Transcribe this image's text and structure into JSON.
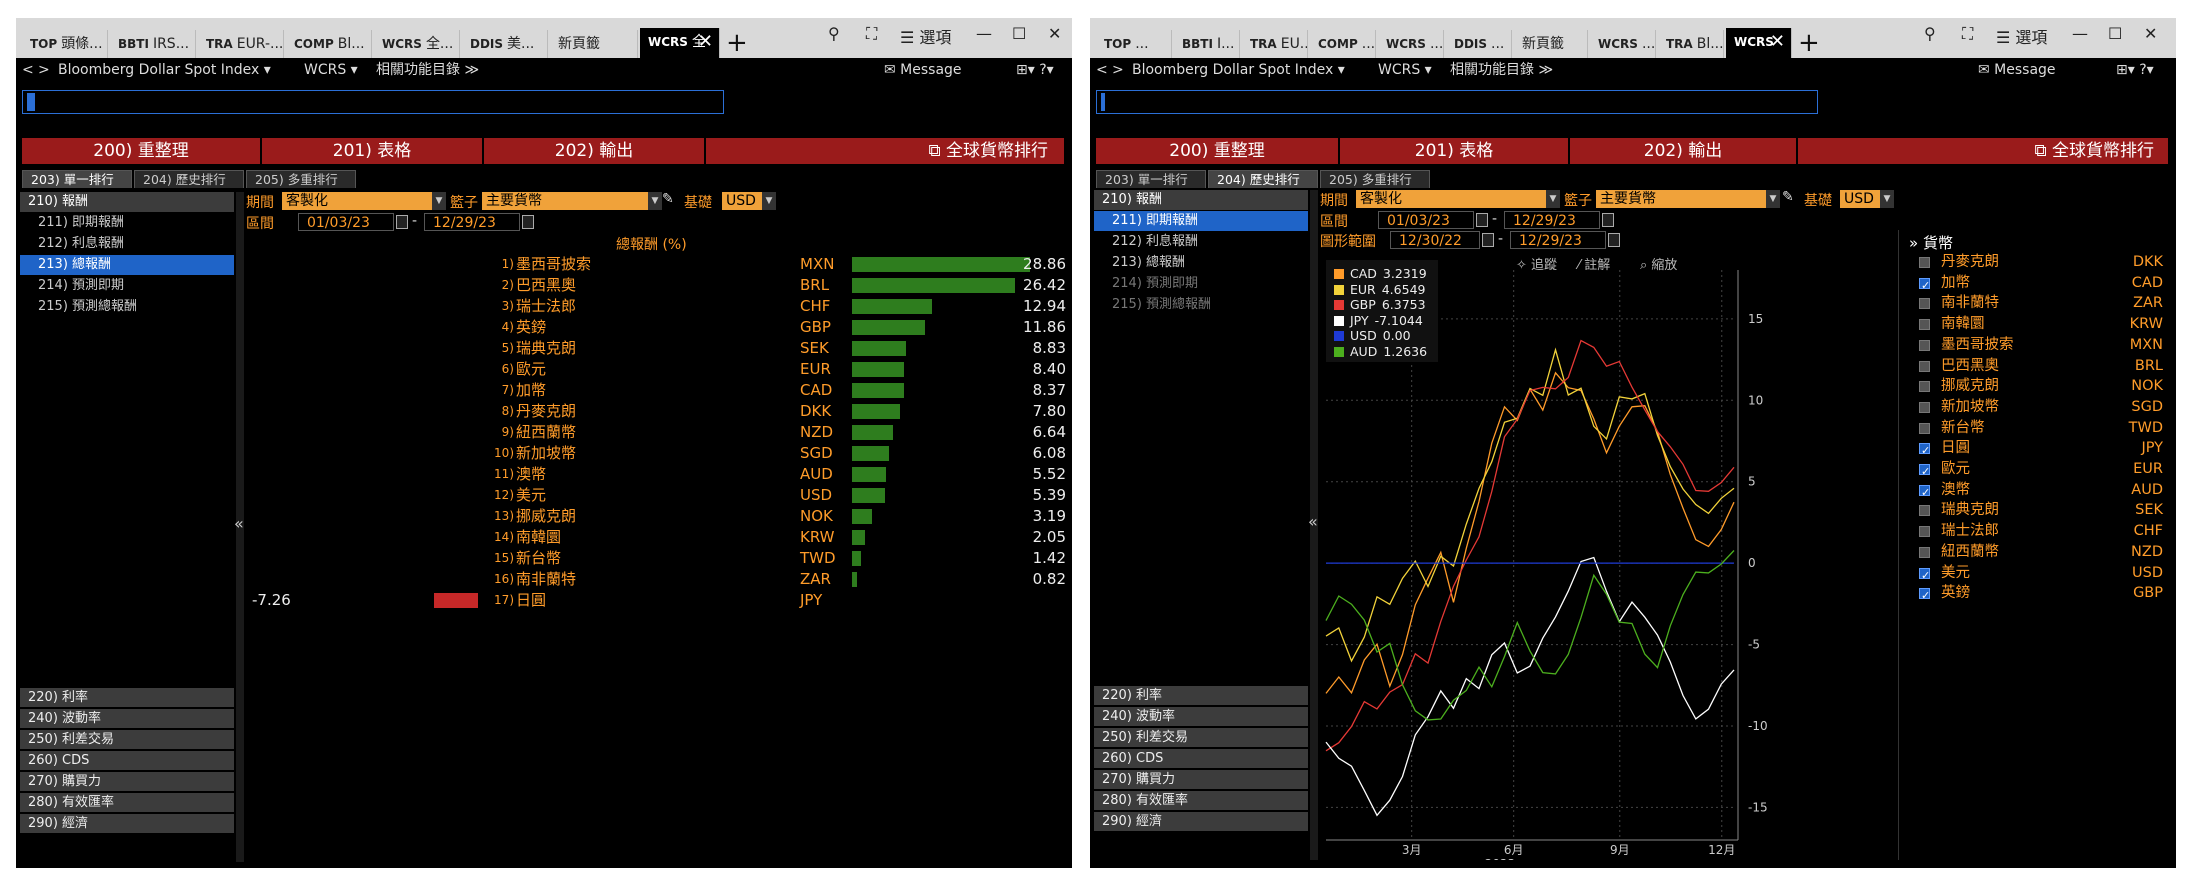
{
  "left": {
    "tabs": [
      {
        "code": "TOP",
        "label": "頭條..."
      },
      {
        "code": "BBTI",
        "label": "IRS..."
      },
      {
        "code": "TRA",
        "label": "EUR-..."
      },
      {
        "code": "COMP",
        "label": "Bl..."
      },
      {
        "code": "WCRS",
        "label": "全..."
      },
      {
        "code": "DDIS",
        "label": "美..."
      },
      {
        "code": "",
        "label": "新頁籤"
      },
      {
        "code": "WCRS",
        "label": "全"
      }
    ],
    "options_label": "☰ 選項",
    "menu": {
      "back": "<",
      "fwd": ">",
      "security": "Bloomberg Dollar Spot Index ▾",
      "function": "WCRS ▾",
      "related": "相關功能目錄 ≫",
      "message": "✉ Message",
      "icons": "⊞▾ ?▾"
    },
    "redbar": [
      "200) 重整理",
      "201) 表格",
      "202) 輸出",
      "全球貨幣排行"
    ],
    "subtabs": [
      "203) 單一排行",
      "204) 歷史排行",
      "205) 多重排行"
    ],
    "sidebar": [
      {
        "label": "210) 報酬",
        "kind": "hdr"
      },
      {
        "label": "211) 即期報酬",
        "kind": "sub"
      },
      {
        "label": "212) 利息報酬",
        "kind": "sub"
      },
      {
        "label": "213) 總報酬",
        "kind": "sel"
      },
      {
        "label": "214) 預測即期",
        "kind": "sub"
      },
      {
        "label": "215) 預測總報酬",
        "kind": "sub"
      }
    ],
    "sidegroups": [
      "220) 利率",
      "240) 波動率",
      "250) 利差交易",
      "260) CDS",
      "270) 購買力",
      "280) 有效匯率",
      "290) 經濟"
    ],
    "controls": {
      "period_label": "期間",
      "period": "客製化",
      "basket_label": "籃子",
      "basket": "主要貨幣",
      "base_label": "基礎",
      "base": "USD",
      "range_label": "區間",
      "from": "01/03/23",
      "dash": "-",
      "to": "12/29/23"
    },
    "column_header": "總報酬 (%)",
    "collapse": "«",
    "ranking": [
      {
        "rank": "1)",
        "name": "墨西哥披索",
        "code": "MXN",
        "value": "28.86",
        "v": 28.86
      },
      {
        "rank": "2)",
        "name": "巴西黑奧",
        "code": "BRL",
        "value": "26.42",
        "v": 26.42
      },
      {
        "rank": "3)",
        "name": "瑞士法郎",
        "code": "CHF",
        "value": "12.94",
        "v": 12.94
      },
      {
        "rank": "4)",
        "name": "英鎊",
        "code": "GBP",
        "value": "11.86",
        "v": 11.86
      },
      {
        "rank": "5)",
        "name": "瑞典克朗",
        "code": "SEK",
        "value": "8.83",
        "v": 8.83
      },
      {
        "rank": "6)",
        "name": "歐元",
        "code": "EUR",
        "value": "8.40",
        "v": 8.4
      },
      {
        "rank": "7)",
        "name": "加幣",
        "code": "CAD",
        "value": "8.37",
        "v": 8.37
      },
      {
        "rank": "8)",
        "name": "丹麥克朗",
        "code": "DKK",
        "value": "7.80",
        "v": 7.8
      },
      {
        "rank": "9)",
        "name": "紐西蘭幣",
        "code": "NZD",
        "value": "6.64",
        "v": 6.64
      },
      {
        "rank": "10)",
        "name": "新加坡幣",
        "code": "SGD",
        "value": "6.08",
        "v": 6.08
      },
      {
        "rank": "11)",
        "name": "澳幣",
        "code": "AUD",
        "value": "5.52",
        "v": 5.52
      },
      {
        "rank": "12)",
        "name": "美元",
        "code": "USD",
        "value": "5.39",
        "v": 5.39
      },
      {
        "rank": "13)",
        "name": "挪威克朗",
        "code": "NOK",
        "value": "3.19",
        "v": 3.19
      },
      {
        "rank": "14)",
        "name": "南韓圜",
        "code": "KRW",
        "value": "2.05",
        "v": 2.05
      },
      {
        "rank": "15)",
        "name": "新台幣",
        "code": "TWD",
        "value": "1.42",
        "v": 1.42
      },
      {
        "rank": "16)",
        "name": "南非蘭特",
        "code": "ZAR",
        "value": "0.82",
        "v": 0.82
      },
      {
        "rank": "17)",
        "name": "日圓",
        "code": "JPY",
        "value": "-7.26",
        "v": -7.26
      }
    ]
  },
  "right": {
    "tabs": [
      {
        "code": "TOP",
        "label": "..."
      },
      {
        "code": "BBTI",
        "label": "I..."
      },
      {
        "code": "TRA",
        "label": "EU..."
      },
      {
        "code": "COMP",
        "label": "..."
      },
      {
        "code": "WCRS",
        "label": "..."
      },
      {
        "code": "DDIS",
        "label": "..."
      },
      {
        "code": "",
        "label": "新頁籤"
      },
      {
        "code": "WCRS",
        "label": "..."
      },
      {
        "code": "TRA",
        "label": "Bl..."
      },
      {
        "code": "WCRS",
        "label": ""
      }
    ],
    "options_label": "☰ 選項",
    "menu": {
      "back": "<",
      "fwd": ">",
      "security": "Bloomberg Dollar Spot Index ▾",
      "function": "WCRS ▾",
      "related": "相關功能目錄 ≫",
      "message": "✉ Message",
      "icons": "⊞▾ ?▾"
    },
    "redbar": [
      "200) 重整理",
      "201) 表格",
      "202) 輸出",
      "全球貨幣排行"
    ],
    "subtabs": [
      "203) 單一排行",
      "204) 歷史排行",
      "205) 多重排行"
    ],
    "sidebar": [
      {
        "label": "210) 報酬",
        "kind": "hdr"
      },
      {
        "label": "211) 即期報酬",
        "kind": "sel"
      },
      {
        "label": "212) 利息報酬",
        "kind": "sub"
      },
      {
        "label": "213) 總報酬",
        "kind": "sub"
      },
      {
        "label": "214) 預測即期",
        "kind": "dim"
      },
      {
        "label": "215) 預測總報酬",
        "kind": "dim"
      }
    ],
    "sidegroups": [
      "220) 利率",
      "240) 波動率",
      "250) 利差交易",
      "260) CDS",
      "270) 購買力",
      "280) 有效匯率",
      "290) 經濟"
    ],
    "controls": {
      "period_label": "期間",
      "period": "客製化",
      "basket_label": "籃子",
      "basket": "主要貨幣",
      "base_label": "基礎",
      "base": "USD",
      "range_label": "區間",
      "from": "01/03/23",
      "dash": "-",
      "to": "12/29/23",
      "chart_range_label": "圖形範圍",
      "cfrom": "12/30/22",
      "cto": "12/29/23"
    },
    "chart_tools": [
      "✧ 追蹤",
      "⁄ 註解",
      "⌕ 縮放"
    ],
    "collapse": "«",
    "currency_header": "» 貨幣",
    "currencies": [
      {
        "name": "丹麥克朗",
        "code": "DKK",
        "checked": false
      },
      {
        "name": "加幣",
        "code": "CAD",
        "checked": true
      },
      {
        "name": "南非蘭特",
        "code": "ZAR",
        "checked": false
      },
      {
        "name": "南韓圜",
        "code": "KRW",
        "checked": false
      },
      {
        "name": "墨西哥披索",
        "code": "MXN",
        "checked": false
      },
      {
        "name": "巴西黑奧",
        "code": "BRL",
        "checked": false
      },
      {
        "name": "挪威克朗",
        "code": "NOK",
        "checked": false
      },
      {
        "name": "新加坡幣",
        "code": "SGD",
        "checked": false
      },
      {
        "name": "新台幣",
        "code": "TWD",
        "checked": false
      },
      {
        "name": "日圓",
        "code": "JPY",
        "checked": true
      },
      {
        "name": "歐元",
        "code": "EUR",
        "checked": true
      },
      {
        "name": "澳幣",
        "code": "AUD",
        "checked": true
      },
      {
        "name": "瑞典克朗",
        "code": "SEK",
        "checked": false
      },
      {
        "name": "瑞士法郎",
        "code": "CHF",
        "checked": false
      },
      {
        "name": "紐西蘭幣",
        "code": "NZD",
        "checked": false
      },
      {
        "name": "美元",
        "code": "USD",
        "checked": true
      },
      {
        "name": "英鎊",
        "code": "GBP",
        "checked": true
      }
    ]
  },
  "chart_data": {
    "type": "line",
    "xlabel": "2023",
    "x_ticks": [
      "3月",
      "6月",
      "9月",
      "12月"
    ],
    "y_ticks": [
      15,
      10,
      5,
      0,
      -5,
      -10,
      -15
    ],
    "ylim": [
      -17,
      18
    ],
    "grid": true,
    "legend_position": "top-left",
    "series": [
      {
        "name": "CAD",
        "last": "3.2319",
        "color": "#ff9b2a",
        "values": [
          -8,
          -7.5,
          -8.5,
          -6,
          -4.5,
          -7,
          -5.5,
          -3,
          -1.5,
          0.5,
          -2,
          1.5,
          4,
          7,
          9,
          8.5,
          11,
          10,
          12,
          10.5,
          10,
          8.5,
          7,
          9,
          10,
          9.5,
          7.5,
          5,
          3.5,
          2,
          1.5,
          2,
          3.2
        ]
      },
      {
        "name": "EUR",
        "last": "4.6549",
        "color": "#f2d23a",
        "values": [
          -5,
          -4,
          -5.5,
          -4,
          -2,
          -3,
          -1.5,
          0,
          -1,
          1,
          0,
          2,
          4,
          6,
          9,
          9.5,
          11,
          10,
          12.5,
          10,
          11,
          9,
          8,
          10,
          9.5,
          10,
          8,
          6.5,
          5,
          3.5,
          2.5,
          3.5,
          4.65
        ]
      },
      {
        "name": "GBP",
        "last": "6.3753",
        "color": "#e53935",
        "values": [
          -11,
          -10.5,
          -10,
          -9,
          -9.5,
          -8,
          -7,
          -5,
          -6,
          -4,
          -2,
          0,
          2,
          5,
          8,
          8.5,
          10,
          10.5,
          11,
          12,
          14,
          13,
          11.5,
          12,
          11,
          10,
          8.5,
          7,
          5.5,
          4,
          4.5,
          5.5,
          6.38
        ]
      },
      {
        "name": "JPY",
        "last": "-7.1044",
        "color": "#ffffff",
        "values": [
          -11,
          -12.5,
          -13,
          -14,
          -15,
          -14,
          -13,
          -11,
          -10,
          -8,
          -8.5,
          -6.5,
          -7.5,
          -6,
          -5.5,
          -7,
          -6,
          -4,
          -3,
          -2,
          -0.5,
          0,
          -1.5,
          -3,
          -2,
          -3.5,
          -5,
          -6.5,
          -8,
          -9,
          -8.5,
          -7.5,
          -7.1
        ]
      },
      {
        "name": "USD",
        "last": "0.00",
        "color": "#1e3ad6",
        "values": [
          0,
          0,
          0,
          0,
          0,
          0,
          0,
          0,
          0,
          0,
          0,
          0,
          0,
          0,
          0,
          0,
          0,
          0,
          0,
          0,
          0,
          0,
          0,
          0,
          0,
          0,
          0,
          0,
          0,
          0,
          0,
          0,
          0
        ]
      },
      {
        "name": "AUD",
        "last": "1.2636",
        "color": "#4caf1e",
        "values": [
          -3,
          -1.5,
          -2.5,
          -4,
          -6,
          -5,
          -7,
          -8.5,
          -9.5,
          -10,
          -9,
          -8,
          -6,
          -7,
          -5.5,
          -4,
          -6,
          -7,
          -6.5,
          -5,
          -3,
          -1,
          -2.5,
          -4,
          -3.5,
          -5,
          -6,
          -4,
          -2.5,
          -1,
          -0.5,
          0.5,
          1.26
        ]
      }
    ]
  }
}
